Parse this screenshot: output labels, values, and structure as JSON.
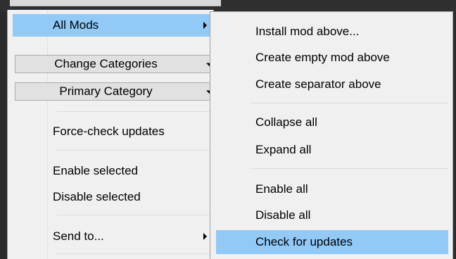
{
  "left_menu": {
    "all_mods": "All Mods",
    "change_categories": "Change Categories",
    "primary_category": "Primary Category",
    "force_check_updates": "Force-check updates",
    "enable_selected": "Enable selected",
    "disable_selected": "Disable selected",
    "send_to": "Send to..."
  },
  "submenu": {
    "install_mod_above": "Install mod above...",
    "create_empty_mod_above": "Create empty mod above",
    "create_separator_above": "Create separator above",
    "collapse_all": "Collapse all",
    "expand_all": "Expand all",
    "enable_all": "Enable all",
    "disable_all": "Disable all",
    "check_for_updates": "Check for updates"
  },
  "colors": {
    "highlight": "#91c9f7",
    "menu_bg": "#f0f0f0",
    "backdrop": "#2b2b2b"
  }
}
